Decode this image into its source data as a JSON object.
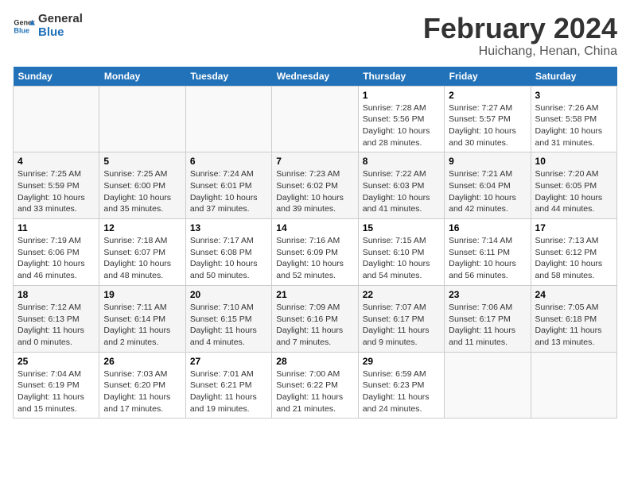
{
  "logo": {
    "line1": "General",
    "line2": "Blue"
  },
  "title": "February 2024",
  "subtitle": "Huichang, Henan, China",
  "weekdays": [
    "Sunday",
    "Monday",
    "Tuesday",
    "Wednesday",
    "Thursday",
    "Friday",
    "Saturday"
  ],
  "weeks": [
    [
      {
        "day": "",
        "info": ""
      },
      {
        "day": "",
        "info": ""
      },
      {
        "day": "",
        "info": ""
      },
      {
        "day": "",
        "info": ""
      },
      {
        "day": "1",
        "info": "Sunrise: 7:28 AM\nSunset: 5:56 PM\nDaylight: 10 hours\nand 28 minutes."
      },
      {
        "day": "2",
        "info": "Sunrise: 7:27 AM\nSunset: 5:57 PM\nDaylight: 10 hours\nand 30 minutes."
      },
      {
        "day": "3",
        "info": "Sunrise: 7:26 AM\nSunset: 5:58 PM\nDaylight: 10 hours\nand 31 minutes."
      }
    ],
    [
      {
        "day": "4",
        "info": "Sunrise: 7:25 AM\nSunset: 5:59 PM\nDaylight: 10 hours\nand 33 minutes."
      },
      {
        "day": "5",
        "info": "Sunrise: 7:25 AM\nSunset: 6:00 PM\nDaylight: 10 hours\nand 35 minutes."
      },
      {
        "day": "6",
        "info": "Sunrise: 7:24 AM\nSunset: 6:01 PM\nDaylight: 10 hours\nand 37 minutes."
      },
      {
        "day": "7",
        "info": "Sunrise: 7:23 AM\nSunset: 6:02 PM\nDaylight: 10 hours\nand 39 minutes."
      },
      {
        "day": "8",
        "info": "Sunrise: 7:22 AM\nSunset: 6:03 PM\nDaylight: 10 hours\nand 41 minutes."
      },
      {
        "day": "9",
        "info": "Sunrise: 7:21 AM\nSunset: 6:04 PM\nDaylight: 10 hours\nand 42 minutes."
      },
      {
        "day": "10",
        "info": "Sunrise: 7:20 AM\nSunset: 6:05 PM\nDaylight: 10 hours\nand 44 minutes."
      }
    ],
    [
      {
        "day": "11",
        "info": "Sunrise: 7:19 AM\nSunset: 6:06 PM\nDaylight: 10 hours\nand 46 minutes."
      },
      {
        "day": "12",
        "info": "Sunrise: 7:18 AM\nSunset: 6:07 PM\nDaylight: 10 hours\nand 48 minutes."
      },
      {
        "day": "13",
        "info": "Sunrise: 7:17 AM\nSunset: 6:08 PM\nDaylight: 10 hours\nand 50 minutes."
      },
      {
        "day": "14",
        "info": "Sunrise: 7:16 AM\nSunset: 6:09 PM\nDaylight: 10 hours\nand 52 minutes."
      },
      {
        "day": "15",
        "info": "Sunrise: 7:15 AM\nSunset: 6:10 PM\nDaylight: 10 hours\nand 54 minutes."
      },
      {
        "day": "16",
        "info": "Sunrise: 7:14 AM\nSunset: 6:11 PM\nDaylight: 10 hours\nand 56 minutes."
      },
      {
        "day": "17",
        "info": "Sunrise: 7:13 AM\nSunset: 6:12 PM\nDaylight: 10 hours\nand 58 minutes."
      }
    ],
    [
      {
        "day": "18",
        "info": "Sunrise: 7:12 AM\nSunset: 6:13 PM\nDaylight: 11 hours\nand 0 minutes."
      },
      {
        "day": "19",
        "info": "Sunrise: 7:11 AM\nSunset: 6:14 PM\nDaylight: 11 hours\nand 2 minutes."
      },
      {
        "day": "20",
        "info": "Sunrise: 7:10 AM\nSunset: 6:15 PM\nDaylight: 11 hours\nand 4 minutes."
      },
      {
        "day": "21",
        "info": "Sunrise: 7:09 AM\nSunset: 6:16 PM\nDaylight: 11 hours\nand 7 minutes."
      },
      {
        "day": "22",
        "info": "Sunrise: 7:07 AM\nSunset: 6:17 PM\nDaylight: 11 hours\nand 9 minutes."
      },
      {
        "day": "23",
        "info": "Sunrise: 7:06 AM\nSunset: 6:17 PM\nDaylight: 11 hours\nand 11 minutes."
      },
      {
        "day": "24",
        "info": "Sunrise: 7:05 AM\nSunset: 6:18 PM\nDaylight: 11 hours\nand 13 minutes."
      }
    ],
    [
      {
        "day": "25",
        "info": "Sunrise: 7:04 AM\nSunset: 6:19 PM\nDaylight: 11 hours\nand 15 minutes."
      },
      {
        "day": "26",
        "info": "Sunrise: 7:03 AM\nSunset: 6:20 PM\nDaylight: 11 hours\nand 17 minutes."
      },
      {
        "day": "27",
        "info": "Sunrise: 7:01 AM\nSunset: 6:21 PM\nDaylight: 11 hours\nand 19 minutes."
      },
      {
        "day": "28",
        "info": "Sunrise: 7:00 AM\nSunset: 6:22 PM\nDaylight: 11 hours\nand 21 minutes."
      },
      {
        "day": "29",
        "info": "Sunrise: 6:59 AM\nSunset: 6:23 PM\nDaylight: 11 hours\nand 24 minutes."
      },
      {
        "day": "",
        "info": ""
      },
      {
        "day": "",
        "info": ""
      }
    ]
  ]
}
